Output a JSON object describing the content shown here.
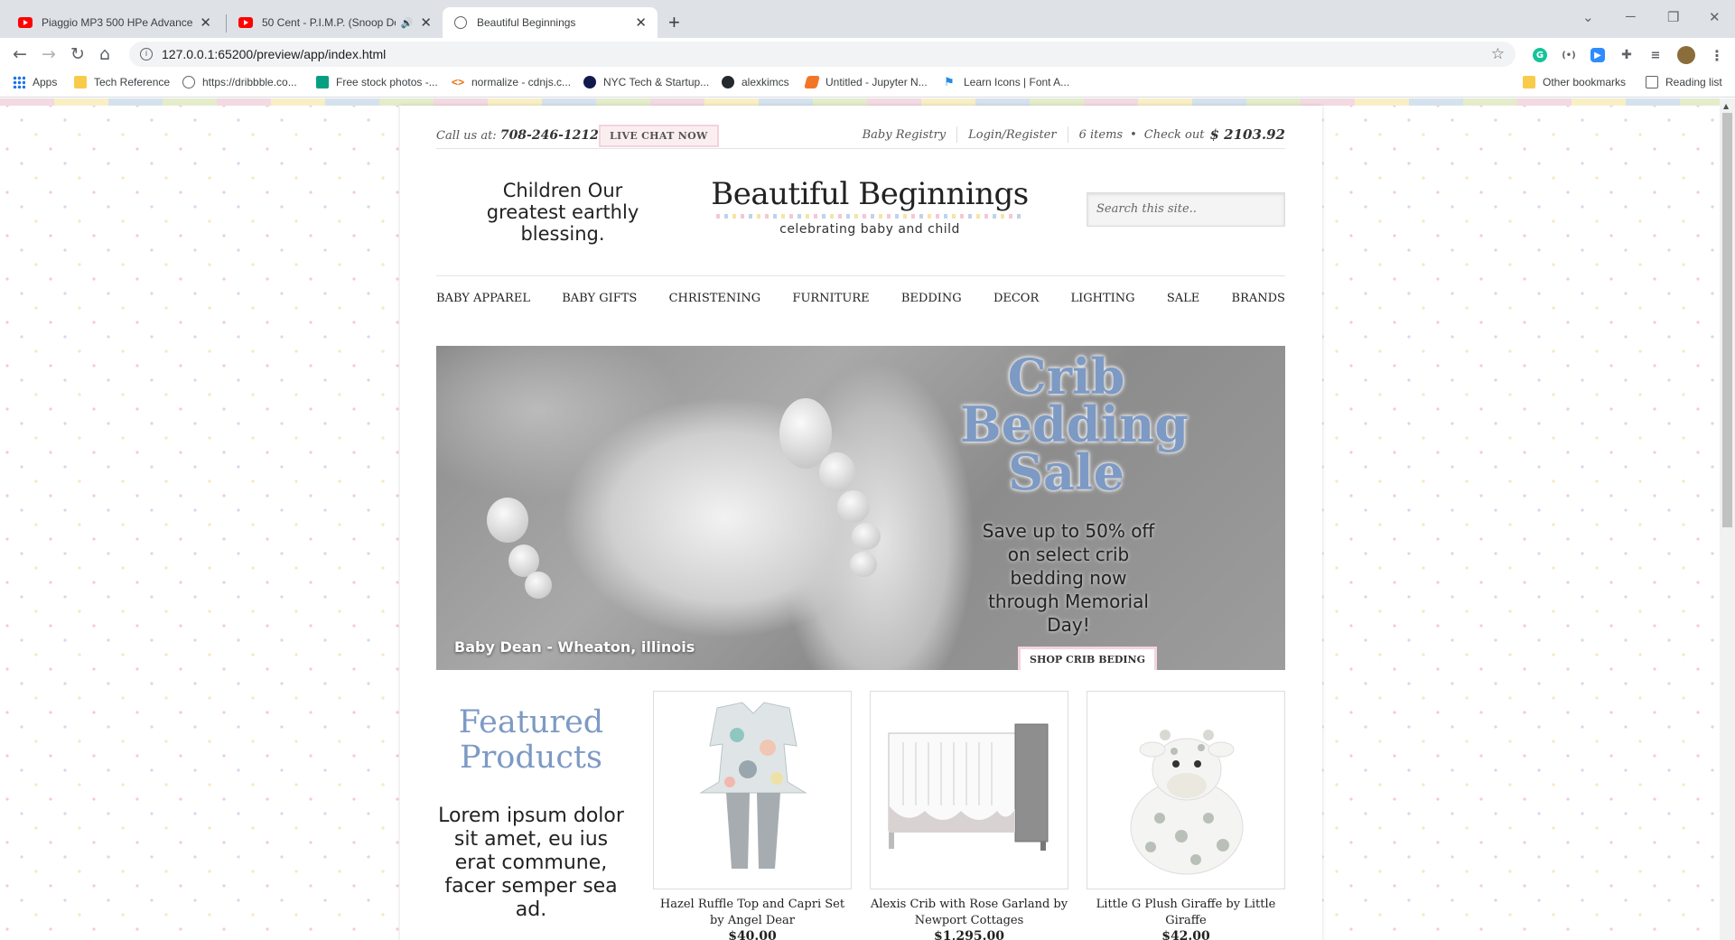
{
  "tabs": [
    {
      "title": "Piaggio MP3 500 HPe Advanced",
      "icon": "youtube-icon"
    },
    {
      "title": "50 Cent - P.I.M.P. (Snoop Do",
      "icon": "youtube-icon"
    },
    {
      "title": "Beautiful Beginnings",
      "icon": "globe-icon"
    }
  ],
  "address": {
    "url": "127.0.0.1:65200/preview/app/index.html"
  },
  "bookmarks": [
    {
      "label": "Apps"
    },
    {
      "label": "Tech Reference"
    },
    {
      "label": "https://dribbble.co..."
    },
    {
      "label": "Free stock photos -..."
    },
    {
      "label": "normalize - cdnjs.c..."
    },
    {
      "label": "NYC Tech & Startup..."
    },
    {
      "label": "alexkimcs"
    },
    {
      "label": "Untitled - Jupyter N..."
    },
    {
      "label": "Learn Icons | Font A..."
    },
    {
      "label": "Other bookmarks"
    },
    {
      "label": "Reading list"
    }
  ],
  "utility": {
    "call_label": "Call us at:",
    "phone": "708-246-1212",
    "live_chat": "LIVE CHAT NOW",
    "registry": "Baby Registry",
    "login": "Login/Register",
    "items": "6 items",
    "bullet": "•",
    "checkout": "Check out",
    "total": "$ 2103.92"
  },
  "header": {
    "tagline": "Children Our greatest earthly blessing.",
    "logo_name": "Beautiful Beginnings",
    "logo_sub": "celebrating baby and child",
    "search_placeholder": "Search this site.."
  },
  "nav": [
    "BABY APPAREL",
    "BABY GIFTS",
    "CHRISTENING",
    "FURNITURE",
    "BEDDING",
    "DECOR",
    "LIGHTING",
    "SALE",
    "BRANDS"
  ],
  "hero": {
    "headline": "Crib Bedding Sale",
    "offer": "Save up to 50% off on select crib bedding now through Memorial Day!",
    "cta": "SHOP CRIB BEDING",
    "caption": "Baby Dean - Wheaton, illinois"
  },
  "featured": {
    "title": "Featured Products",
    "text": "Lorem ipsum dolor sit amet, eu ius erat commune, facer semper sea ad.",
    "products": [
      {
        "name": "Hazel Ruffle Top and Capri Set by Angel Dear",
        "price": "$40.00"
      },
      {
        "name": "Alexis Crib with Rose Garland by Newport Cottages",
        "price": "$1,295.00"
      },
      {
        "name": "Little G Plush Giraffe by Little Giraffe",
        "price": "$42.00"
      }
    ]
  },
  "colors": {
    "accent_blue": "#7d9ac4",
    "pink_border": "#f3d3dc"
  }
}
